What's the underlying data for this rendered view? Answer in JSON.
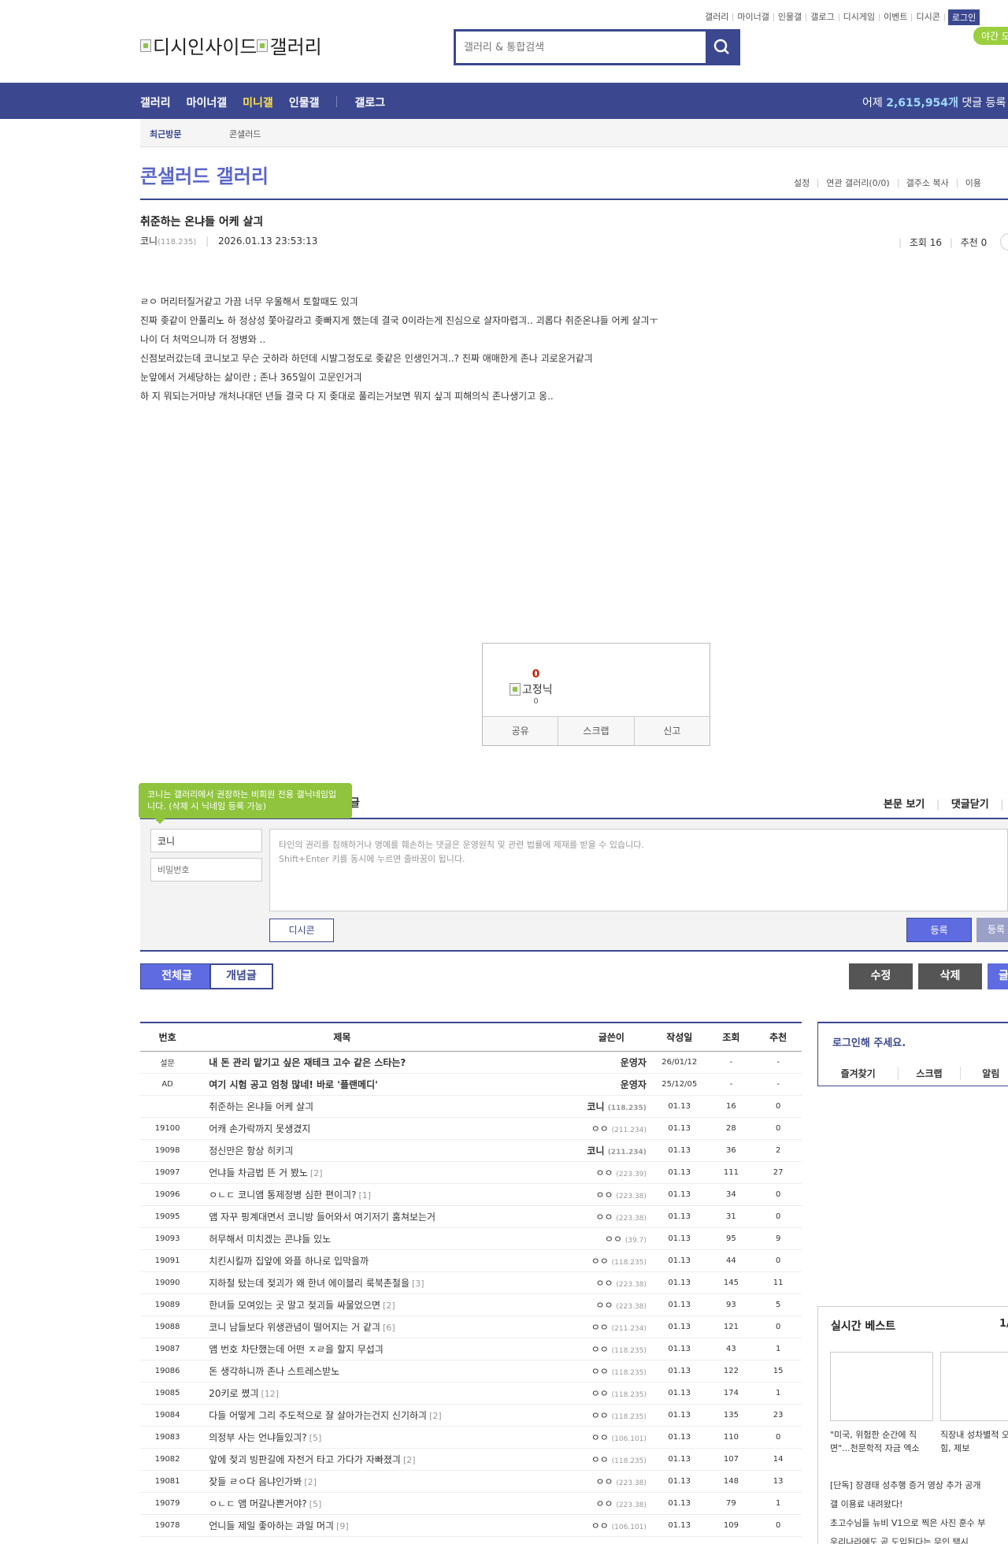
{
  "top_links": [
    "갤러리",
    "마이너갤",
    "인물갤",
    "갤로그",
    "디시게임",
    "이벤트",
    "디시콘"
  ],
  "login_label": "로그인",
  "night_label": "야간 모",
  "logo_text": {
    "part1": "디시인사이드",
    "part2": "갤러리"
  },
  "search": {
    "placeholder": "갤러리 & 통합검색"
  },
  "nav": {
    "items": [
      "갤러리",
      "마이너갤",
      "미니갤",
      "인물갤"
    ],
    "active_index": 2,
    "gallog": "갤로그",
    "stat_prefix": "어제",
    "stat_value": "2,615,954개",
    "stat_suffix": "댓글 등록"
  },
  "recent": {
    "label": "최근방문",
    "item": "콘샐러드"
  },
  "gallery": {
    "title": "콘샐러드 갤러리",
    "menu": [
      "설정",
      "연관 갤러리(0/0)",
      "갤주소 복사",
      "이용"
    ]
  },
  "post": {
    "title": "취준하는 온냐들 어케 살긔",
    "author": "코니",
    "author_ip": "(118.235)",
    "datetime": "2026.01.13 23:53:13",
    "views_label": "조회 16",
    "recommend_label": "추천 0",
    "body": [
      "ㄹㅇ 머리터질거같고 가끔 너무 우울해서 토할때도 있긔",
      "진짜 좆같이 안풀리노 하 정상성 쫓아갈라고 좆빠지게 했는데 결국 0이라는게 진심으로 살자마렵긔.. 괴롭다 취준온냐들 어케 살긔ㅜ",
      "나이 더 처먹으니까 더 정병와 ..",
      "신점보러갔는데 코니보고 무슨 굿하라 하던데 시발그정도로 좆같은 인생인거긔..? 진짜 애매한게 존나 괴로운거같긔",
      "눈앞에서 거세당하는 삶이란 ; 존나 365일이 고문인거긔",
      "하 지 뭐되는거마냥 개처나대던 년들 결국 다 지 좆대로 풀리는거보면 뭐지 싶긔 피해의식 존나생기고 옹.."
    ]
  },
  "recommend_box": {
    "count": "0",
    "nick": "고정닉",
    "nick_count": "0",
    "actions": [
      "공유",
      "스크랩",
      "신고"
    ]
  },
  "comments": {
    "tooltip": "코니는 갤러리에서 권장하는 비회원 전용 갤닉네임입니다. (삭제 시 닉네임 등록 가능)",
    "title_fragment": "글",
    "links": [
      "본문 보기",
      "댓글닫기"
    ],
    "nick_value": "코니",
    "password_placeholder": "비밀번호",
    "notice_line1": "타인의 권리를 침해하거나 명예를 훼손하는 댓글은 운영원칙 및 관련 법률에 제재를 받을 수 있습니다.",
    "notice_line2": "Shift+Enter 키를 동시에 누르면 줄바꿈이 됩니다.",
    "dccon_label": "디시콘",
    "submit_label": "등록",
    "submit2_label": "등록"
  },
  "list_buttons": {
    "all": "전체글",
    "concept": "개념글",
    "edit": "수정",
    "delete": "삭제",
    "write": "글"
  },
  "table": {
    "headers": [
      "번호",
      "제목",
      "글쓴이",
      "작성일",
      "조회",
      "추천"
    ],
    "rows": [
      {
        "num": "설문",
        "subject": "내 돈 관리 맡기고 싶은 재테크 고수 같은 스타는?",
        "reply": "",
        "writer": "운영자",
        "ip": "",
        "date": "26/01/12",
        "views": "-",
        "rec": "-",
        "notice": true
      },
      {
        "num": "AD",
        "subject": "여기 시험 공고 엄청 많네! 바로 '플랜메디'",
        "reply": "",
        "writer": "운영자",
        "ip": "",
        "date": "25/12/05",
        "views": "-",
        "rec": "-",
        "notice": true
      },
      {
        "num": "",
        "subject": "취준하는 온냐들 어케 살긔",
        "reply": "",
        "writer": "코니",
        "ip": "(118.235)",
        "date": "01.13",
        "views": "16",
        "rec": "0"
      },
      {
        "num": "19100",
        "subject": "어캐 손가락까지 못생겼지",
        "reply": "",
        "writer": "ㅇㅇ",
        "ip": "(211.234)",
        "date": "01.13",
        "views": "28",
        "rec": "0"
      },
      {
        "num": "19098",
        "subject": "정신만은 항상 히키긔",
        "reply": "",
        "writer": "코니",
        "ip": "(211.234)",
        "date": "01.13",
        "views": "36",
        "rec": "2"
      },
      {
        "num": "19097",
        "subject": "언냐들 차금법 뜬 거 봤노",
        "reply": "[2]",
        "writer": "ㅇㅇ",
        "ip": "(223.39)",
        "date": "01.13",
        "views": "111",
        "rec": "27"
      },
      {
        "num": "19096",
        "subject": "ㅇㄴㄷ 코니앰 통제정병 심한 편이긔?",
        "reply": "[1]",
        "writer": "ㅇㅇ",
        "ip": "(223.38)",
        "date": "01.13",
        "views": "34",
        "rec": "0"
      },
      {
        "num": "19095",
        "subject": "앰 자꾸 핑계대면서 코니방 들어와서 여기저기 훔쳐보는거",
        "reply": "",
        "writer": "ㅇㅇ",
        "ip": "(223.38)",
        "date": "01.13",
        "views": "31",
        "rec": "0"
      },
      {
        "num": "19093",
        "subject": "허무해서 미치겠는 콘냐들 있노",
        "reply": "",
        "writer": "ㅇㅇ",
        "ip": "(39.7)",
        "date": "01.13",
        "views": "95",
        "rec": "9"
      },
      {
        "num": "19091",
        "subject": "치킨시킬까 집앞에 와플 하나로 입막을까",
        "reply": "",
        "writer": "ㅇㅇ",
        "ip": "(118.235)",
        "date": "01.13",
        "views": "44",
        "rec": "0"
      },
      {
        "num": "19090",
        "subject": "지하철 탔는데 젖괴가 왜 한녀 에이블리 룩북촌철을",
        "reply": "[3]",
        "writer": "ㅇㅇ",
        "ip": "(223.38)",
        "date": "01.13",
        "views": "145",
        "rec": "11"
      },
      {
        "num": "19089",
        "subject": "한녀들 모여있는 곳 말고 젖괴들 싸물었으면",
        "reply": "[2]",
        "writer": "ㅇㅇ",
        "ip": "(223.38)",
        "date": "01.13",
        "views": "93",
        "rec": "5"
      },
      {
        "num": "19088",
        "subject": "코니 남들보다 위생관념이 떨어지는 거 같긔",
        "reply": "[6]",
        "writer": "ㅇㅇ",
        "ip": "(211.234)",
        "date": "01.13",
        "views": "121",
        "rec": "0"
      },
      {
        "num": "19087",
        "subject": "앰 번호 차단했는데 어떤 ㅈㄹ을 할지 무섭긔",
        "reply": "",
        "writer": "ㅇㅇ",
        "ip": "(118.235)",
        "date": "01.13",
        "views": "43",
        "rec": "1"
      },
      {
        "num": "19086",
        "subject": "돈 생각하니까 존나 스트레스받노",
        "reply": "",
        "writer": "ㅇㅇ",
        "ip": "(118.235)",
        "date": "01.13",
        "views": "122",
        "rec": "15"
      },
      {
        "num": "19085",
        "subject": "20키로 쪘긔",
        "reply": "[12]",
        "writer": "ㅇㅇ",
        "ip": "(118.235)",
        "date": "01.13",
        "views": "174",
        "rec": "1"
      },
      {
        "num": "19084",
        "subject": "다들 어떻게 그리 주도적으로 잘 살아가는건지 신기하긔",
        "reply": "[2]",
        "writer": "ㅇㅇ",
        "ip": "(118.235)",
        "date": "01.13",
        "views": "135",
        "rec": "23"
      },
      {
        "num": "19083",
        "subject": "의정부 사는 언냐들있긔?",
        "reply": "[5]",
        "writer": "ㅇㅇ",
        "ip": "(106.101)",
        "date": "01.13",
        "views": "110",
        "rec": "0"
      },
      {
        "num": "19082",
        "subject": "앞에 젖괴 빙판길에 자전거 타고 가다가 자빠졌긔",
        "reply": "[2]",
        "writer": "ㅇㅇ",
        "ip": "(118.235)",
        "date": "01.13",
        "views": "107",
        "rec": "14"
      },
      {
        "num": "19081",
        "subject": "잦들 ㄹㅇ다 음냐인가봐",
        "reply": "[2]",
        "writer": "ㅇㅇ",
        "ip": "(223.38)",
        "date": "01.13",
        "views": "148",
        "rec": "13"
      },
      {
        "num": "19079",
        "subject": "ㅇㄴㄷ 앰 머갈나쁜거야?",
        "reply": "[5]",
        "writer": "ㅇㅇ",
        "ip": "(223.38)",
        "date": "01.13",
        "views": "79",
        "rec": "1"
      },
      {
        "num": "19078",
        "subject": "언니들 제일 좋아하는 과일 머긔",
        "reply": "[9]",
        "writer": "ㅇㅇ",
        "ip": "(106.101)",
        "date": "01.13",
        "views": "109",
        "rec": "0"
      }
    ]
  },
  "sidebar": {
    "login_title": "로그인해 주세요.",
    "login_links": [
      "즐겨찾기",
      "스크랩",
      "알림"
    ],
    "best_title": "실시간 베스트",
    "best_page": "1/",
    "best_captions": [
      "\"미국, 위험한 순간에 직면\"...천문학적 자금 엑소",
      "직장내 성차별적 오적 괴롭힘, 제보"
    ],
    "best_lines": [
      "[단독] 장경태 성추행 증거 영상 추가 공개",
      "갤 이용료 내려왔다!",
      "초고수님들 뉴비 V1으로 찍은 사진 훈수 부",
      "우리나라에도 곧 도입된다는 무인 택시"
    ]
  },
  "colors": {
    "brand": "#3b4890",
    "accent": "#5f6be0",
    "nav_active": "#ffe04b",
    "tooltip": "#8fc43c"
  }
}
